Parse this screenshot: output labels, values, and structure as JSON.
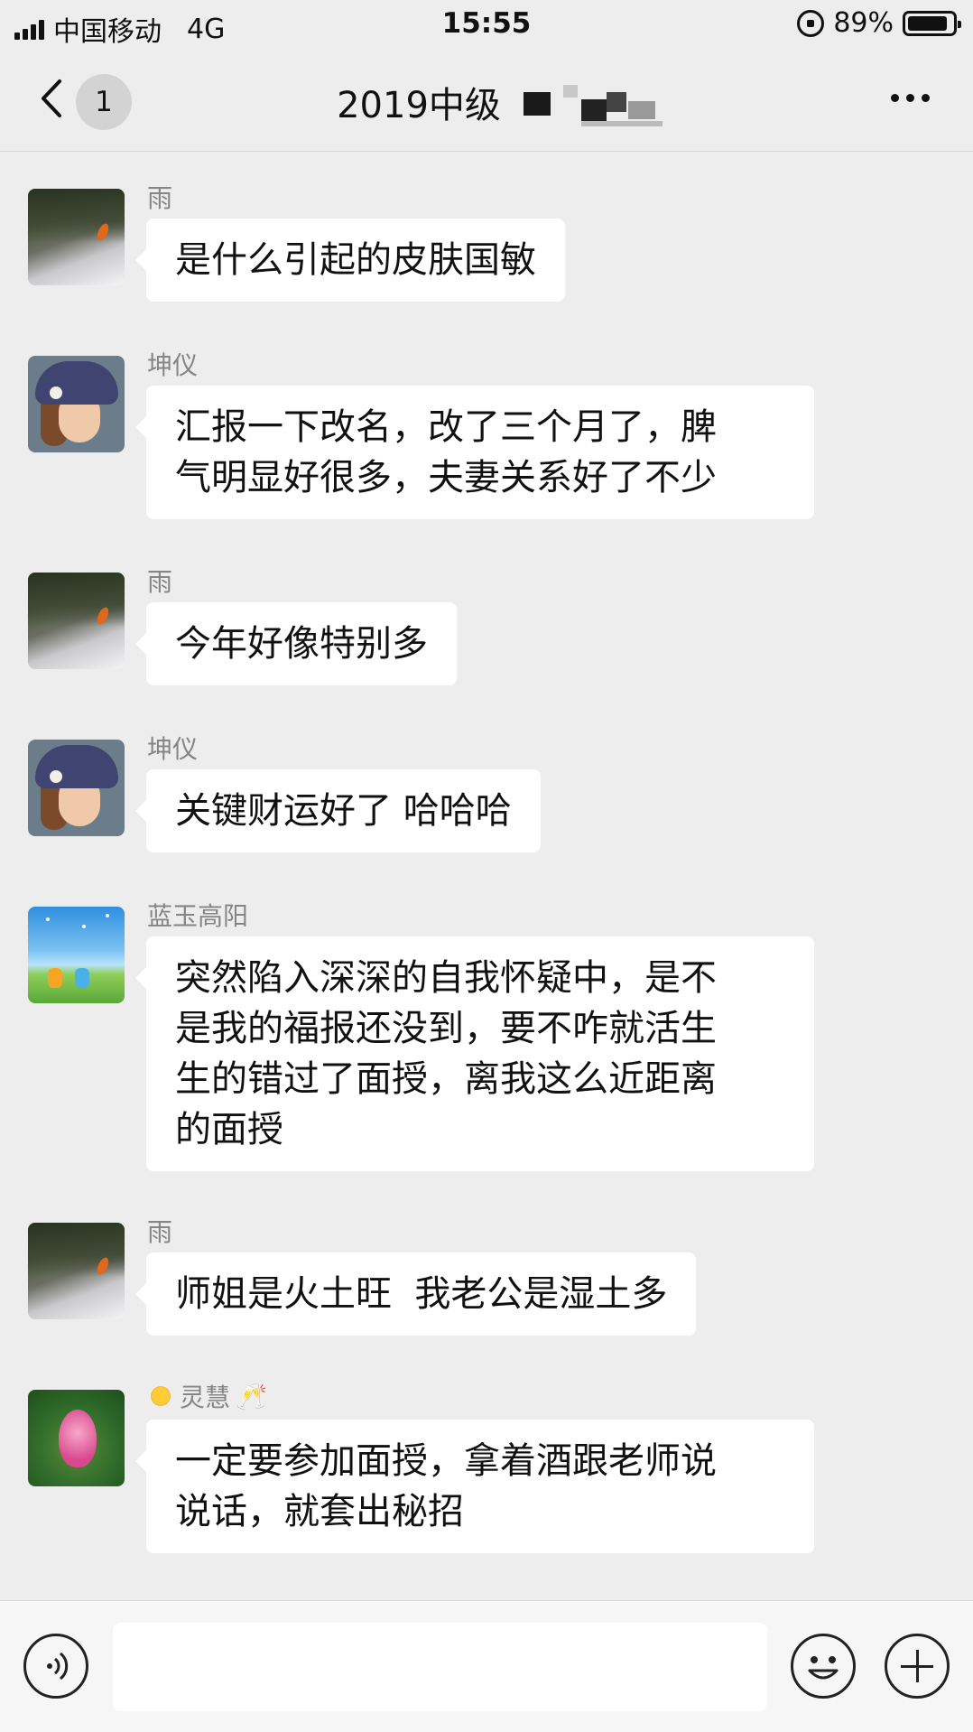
{
  "status_bar": {
    "carrier": "中国移动",
    "network": "4G",
    "time": "15:55",
    "battery_percent": "89%",
    "battery_level": 0.89
  },
  "nav": {
    "back_icon": "chevron-left-icon",
    "unread_count": "1",
    "title": "2019中级",
    "more_icon": "ellipsis-icon"
  },
  "messages": [
    {
      "sender": "雨",
      "avatar": "koi-pond-avatar",
      "text": "是什么引起的皮肤国敏"
    },
    {
      "sender": "坤仪",
      "avatar": "woman-in-hat-avatar",
      "text_lines": [
        "汇报一下改名，改了三个月了，脾",
        "气明显好很多，夫妻关系好了不少"
      ]
    },
    {
      "sender": "雨",
      "avatar": "koi-pond-avatar",
      "text": "今年好像特别多"
    },
    {
      "sender": "坤仪",
      "avatar": "woman-in-hat-avatar",
      "text": "关键财运好了 哈哈哈"
    },
    {
      "sender": "蓝玉高阳",
      "avatar": "cartoon-sky-avatar",
      "text_lines": [
        "突然陷入深深的自我怀疑中，是不",
        "是我的福报还没到，要不咋就活生",
        "生的错过了面授，离我这么近距离",
        "的面授"
      ]
    },
    {
      "sender": "雨",
      "avatar": "koi-pond-avatar",
      "text": "师姐是火土旺  我老公是湿土多"
    },
    {
      "sender": "灵慧",
      "sender_prefix_icon": "sun-emoji-icon",
      "sender_suffix_icon": "cheers-emoji-icon",
      "avatar": "lotus-avatar",
      "text_lines": [
        "一定要参加面授，拿着酒跟老师说",
        "说话，就套出秘招"
      ]
    }
  ],
  "input_bar": {
    "voice_icon": "voice-icon",
    "text_value": "",
    "emoji_icon": "emoji-icon",
    "plus_icon": "plus-icon"
  },
  "colors": {
    "background": "#ededed",
    "bubble": "#ffffff",
    "sender_name": "#858585"
  }
}
